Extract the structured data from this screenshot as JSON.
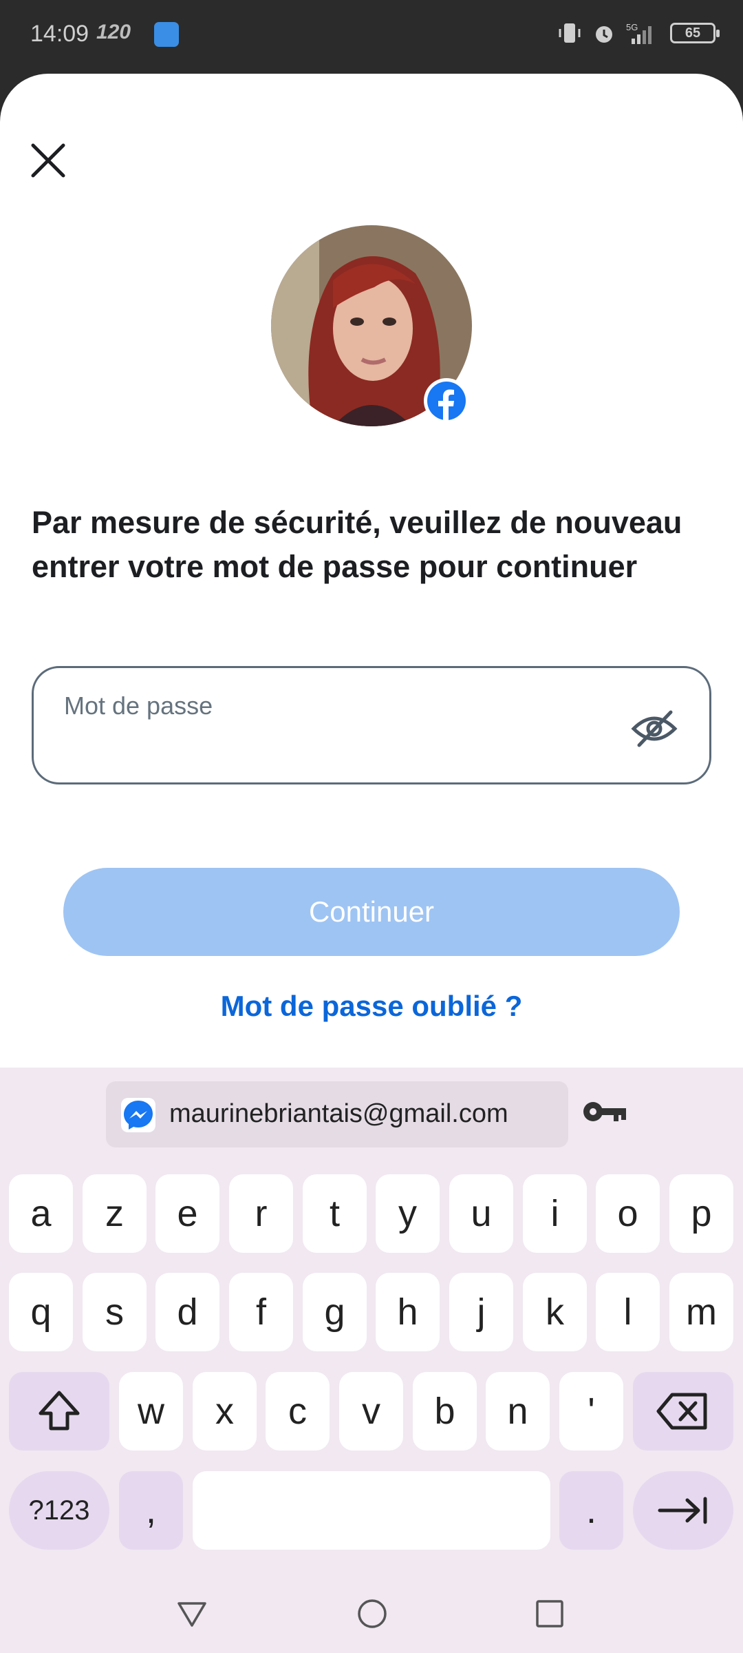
{
  "status_bar": {
    "time": "14:09",
    "refresh": "120",
    "battery": "65"
  },
  "sheet": {
    "headline": "Par mesure de sécurité, veuillez de nouveau entrer votre mot de passe pour continuer",
    "password_placeholder": "Mot de passe",
    "continue_label": "Continuer",
    "forgot_label": "Mot de passe oublié ?",
    "colors": {
      "primary": "#0b66d9",
      "disabled_button": "#9ec4f3",
      "facebook": "#1877f2"
    }
  },
  "keyboard": {
    "suggestion": "maurinebriantais@gmail.com",
    "row1": [
      "a",
      "z",
      "e",
      "r",
      "t",
      "y",
      "u",
      "i",
      "o",
      "p"
    ],
    "row2": [
      "q",
      "s",
      "d",
      "f",
      "g",
      "h",
      "j",
      "k",
      "l",
      "m"
    ],
    "row3": [
      "w",
      "x",
      "c",
      "v",
      "b",
      "n",
      "'"
    ],
    "symbols_label": "?123",
    "comma": ",",
    "period": "."
  }
}
